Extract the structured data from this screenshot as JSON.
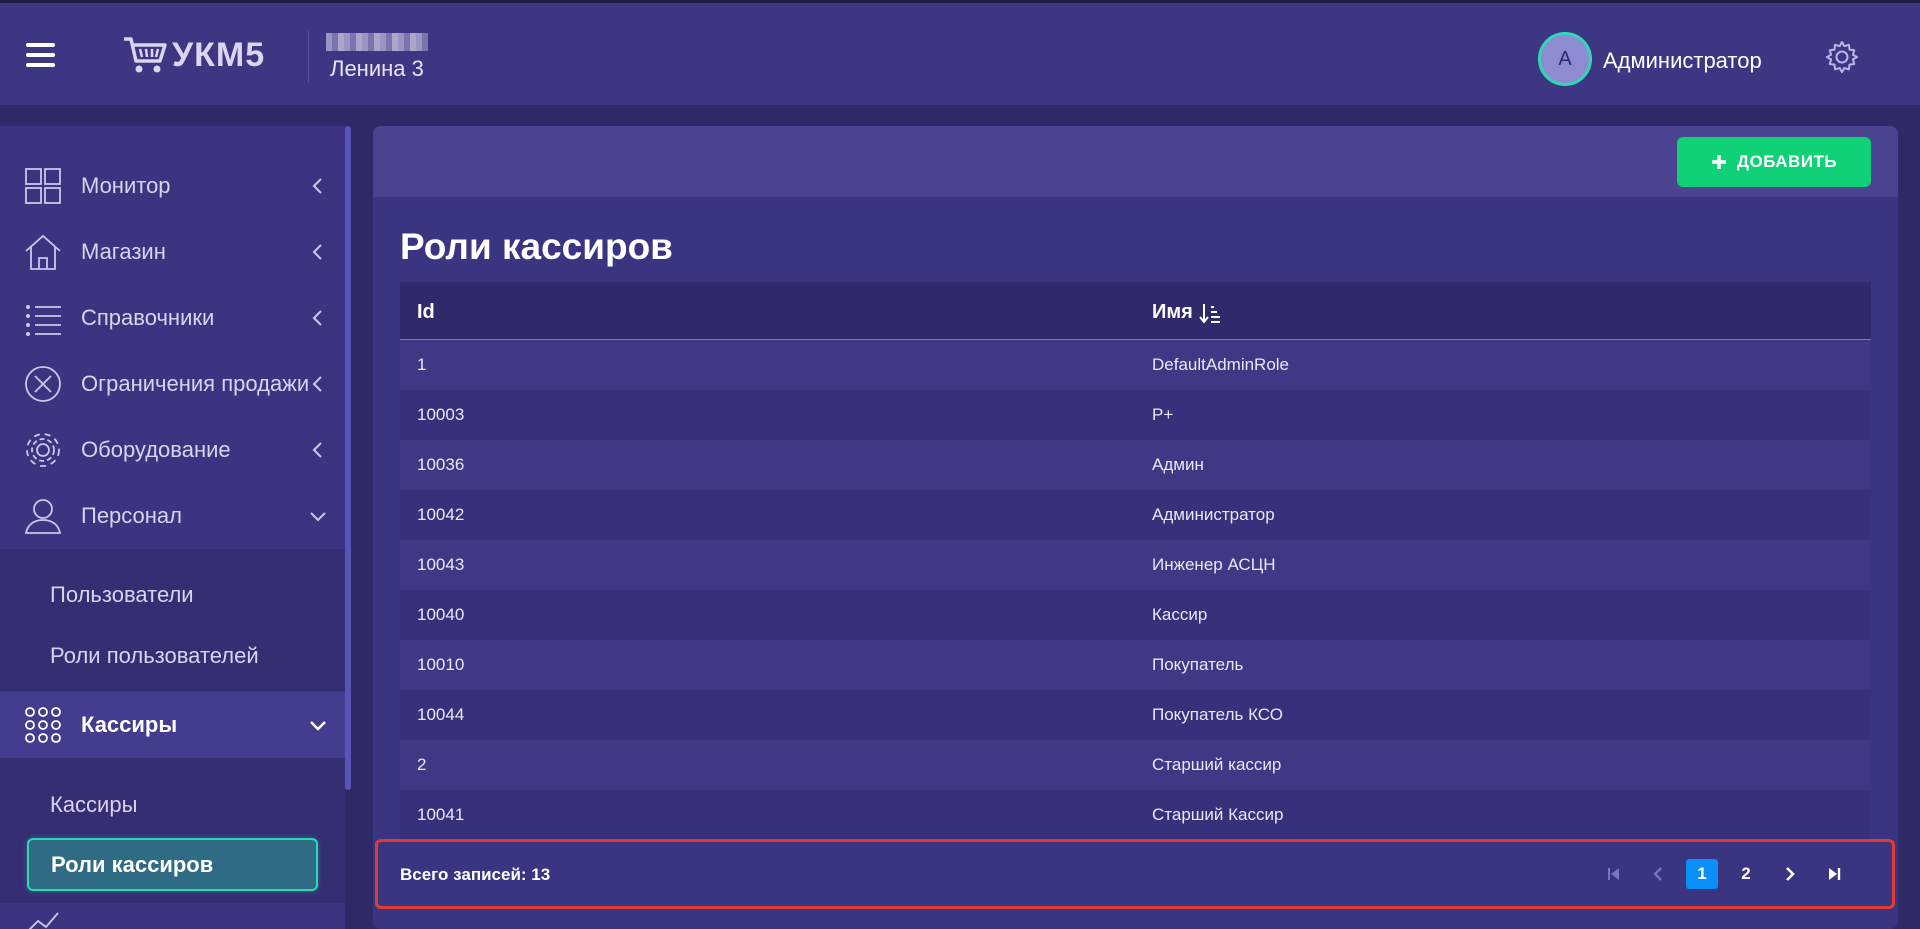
{
  "header": {
    "logo_text": "УКМ5",
    "store_name": "Ленина 3",
    "user_initial": "А",
    "user_name": "Администратор"
  },
  "sidebar": {
    "items": [
      {
        "label": "Монитор",
        "icon": "grid-icon"
      },
      {
        "label": "Магазин",
        "icon": "store-icon"
      },
      {
        "label": "Справочники",
        "icon": "list-icon"
      },
      {
        "label": "Ограничения продажи",
        "icon": "circle-x-icon"
      },
      {
        "label": "Оборудование",
        "icon": "gear-icon"
      },
      {
        "label": "Персонал",
        "icon": "user-icon"
      }
    ],
    "personnel_sub": [
      "Пользователи",
      "Роли пользователей"
    ],
    "cashiers": {
      "label": "Кассиры",
      "icon": "dots-grid-icon"
    },
    "cashiers_sub": [
      "Кассиры",
      "Роли кассиров"
    ]
  },
  "toolbar": {
    "add_label": "ДОБАВИТЬ"
  },
  "page": {
    "title": "Роли кассиров"
  },
  "table": {
    "columns": [
      "Id",
      "Имя"
    ],
    "rows": [
      {
        "id": "1",
        "name": "DefaultAdminRole"
      },
      {
        "id": "10003",
        "name": "P+"
      },
      {
        "id": "10036",
        "name": "Админ"
      },
      {
        "id": "10042",
        "name": "Администратор"
      },
      {
        "id": "10043",
        "name": "Инженер АСЦН"
      },
      {
        "id": "10040",
        "name": "Кассир"
      },
      {
        "id": "10010",
        "name": "Покупатель"
      },
      {
        "id": "10044",
        "name": "Покупатель КСО"
      },
      {
        "id": "2",
        "name": "Старший кассир"
      },
      {
        "id": "10041",
        "name": "Старший Кассир"
      }
    ]
  },
  "footer": {
    "total_label": "Всего записей: 13",
    "pages": [
      "1",
      "2"
    ],
    "current_page": "1"
  },
  "colors": {
    "accent": "#0ed178",
    "active_outline": "#2fd8b5",
    "highlight_border": "#e23a32",
    "page_active": "#0a8ef7"
  }
}
